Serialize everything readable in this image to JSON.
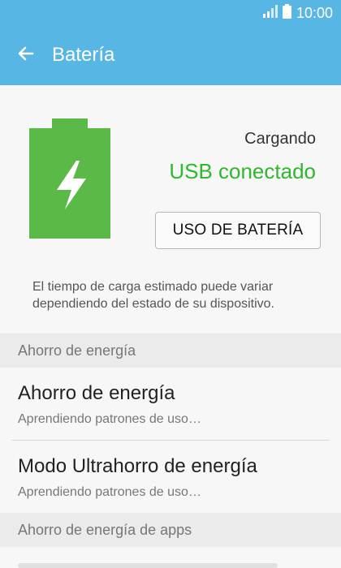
{
  "status_bar": {
    "time": "10:00",
    "signal_icon": "signal-icon",
    "battery_icon": "battery-status-icon"
  },
  "app_bar": {
    "title": "Batería",
    "back_icon": "arrow-left-icon"
  },
  "battery": {
    "icon": "battery-charging-icon",
    "charging_label": "Cargando",
    "connection_status": "USB conectado",
    "usage_button_label": "USO DE BATERÍA",
    "info_text": "El tiempo de carga estimado puede variar dependiendo del estado de su dispositivo."
  },
  "sections": [
    {
      "header": "Ahorro de energía",
      "items": [
        {
          "title": "Ahorro de energía",
          "subtitle": "Aprendiendo patrones de uso…"
        },
        {
          "title": "Modo Ultrahorro de energía",
          "subtitle": "Aprendiendo patrones de uso…"
        }
      ]
    },
    {
      "header": "Ahorro de energía de apps"
    }
  ],
  "colors": {
    "app_bar": "#57b6e3",
    "battery_green": "#5ab947",
    "status_green": "#2eb82e"
  }
}
